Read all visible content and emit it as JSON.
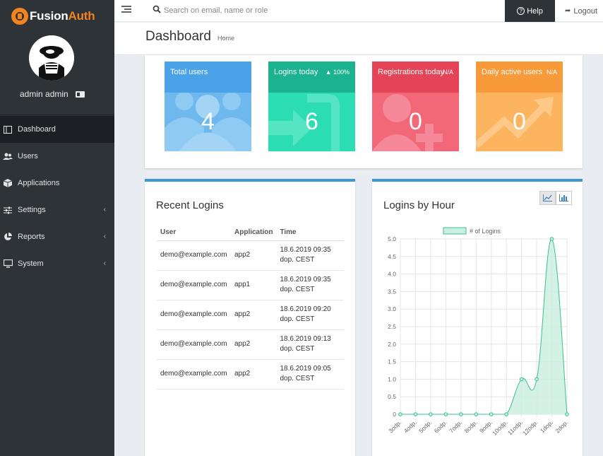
{
  "app": {
    "brand_prefix": "Fusion",
    "brand_suffix": "Auth"
  },
  "user": {
    "name": "admin admin"
  },
  "nav": [
    {
      "label": "Dashboard",
      "icon": "dashboard-icon",
      "active": true
    },
    {
      "label": "Users",
      "icon": "users-icon"
    },
    {
      "label": "Applications",
      "icon": "cube-icon"
    },
    {
      "label": "Settings",
      "icon": "sliders-icon",
      "chevron": "‹"
    },
    {
      "label": "Reports",
      "icon": "pie-chart-icon",
      "chevron": "‹"
    },
    {
      "label": "System",
      "icon": "monitor-icon",
      "chevron": "‹"
    }
  ],
  "topbar": {
    "search_placeholder": "Search on email, name or role",
    "help_label": "Help",
    "logout_label": "Logout"
  },
  "header": {
    "title": "Dashboard",
    "breadcrumb": "Home"
  },
  "stats": [
    {
      "label": "Total users",
      "value": "4",
      "badge": "",
      "color": "#4aa3e8",
      "body_color": "#6fb8ee"
    },
    {
      "label": "Logins today",
      "value": "6",
      "badge": "▲ 100%",
      "color": "#1bb38f",
      "body_color": "#2cdcb2"
    },
    {
      "label": "Registrations today",
      "value": "0",
      "badge": "N/A",
      "color": "#e54457",
      "body_color": "#f26878"
    },
    {
      "label": "Daily active users",
      "value": "0",
      "badge": "N/A",
      "color": "#f99a3a",
      "body_color": "#fdb45f"
    }
  ],
  "recent_logins": {
    "title": "Recent Logins",
    "columns": [
      "User",
      "Application",
      "Time"
    ],
    "rows": [
      {
        "user": "demo@example.com",
        "application": "app2",
        "time_line1": "18.6.2019 09:35",
        "time_line2": "dop. CEST"
      },
      {
        "user": "demo@example.com",
        "application": "app1",
        "time_line1": "18.6.2019 09:35",
        "time_line2": "dop. CEST"
      },
      {
        "user": "demo@example.com",
        "application": "app2",
        "time_line1": "18.6.2019 09:20",
        "time_line2": "dop. CEST"
      },
      {
        "user": "demo@example.com",
        "application": "app2",
        "time_line1": "18.6.2019 09:13",
        "time_line2": "dop. CEST"
      },
      {
        "user": "demo@example.com",
        "application": "app2",
        "time_line1": "18.6.2019 09:05",
        "time_line2": "dop. CEST"
      }
    ]
  },
  "chart_data": {
    "type": "area",
    "title": "Logins by Hour",
    "legend": "# of Logins",
    "legend_position": "top",
    "categories": [
      "3odp.",
      "4odp.",
      "5odp.",
      "6odp.",
      "7odp.",
      "8odp.",
      "9odp.",
      "10odp.",
      "11odp.",
      "12odp.",
      "1dop.",
      "2dop."
    ],
    "series": [
      {
        "name": "# of Logins",
        "values": [
          0,
          0,
          0,
          0,
          0,
          0,
          0,
          0,
          1,
          1,
          5,
          0
        ]
      }
    ],
    "ylim": [
      0,
      5
    ],
    "yticks": [
      "0",
      "0.5",
      "1.0",
      "1.5",
      "2.0",
      "2.5",
      "3.0",
      "3.5",
      "4.0",
      "4.5",
      "5.0"
    ],
    "grid": true,
    "line_color": "#3dbf93",
    "fill_color": "#c8efdf"
  }
}
